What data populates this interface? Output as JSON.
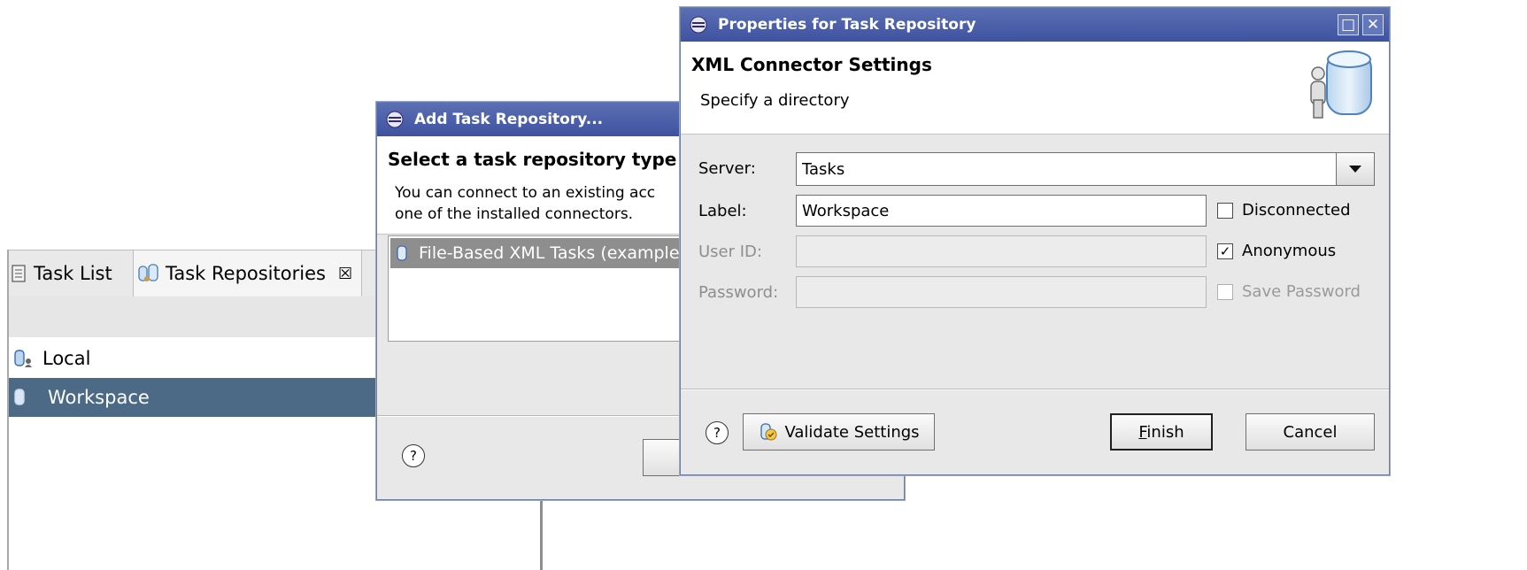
{
  "task_view": {
    "tabs": [
      {
        "label": "Task List"
      },
      {
        "label": "Task Repositories",
        "close": "☒"
      }
    ],
    "repositories": [
      {
        "label": "Local",
        "selected": false
      },
      {
        "label": "Workspace",
        "selected": true
      }
    ]
  },
  "add_dialog": {
    "title": "Add Task Repository...",
    "heading": "Select a task repository type",
    "description_line1": "You can connect to an existing acc",
    "description_line2": "one of the installed connectors.",
    "types": [
      {
        "label": "File-Based XML Tasks (example",
        "selected": true
      }
    ]
  },
  "props_dialog": {
    "title": "Properties for Task Repository",
    "heading": "XML Connector Settings",
    "description": "Specify a directory",
    "server": {
      "label": "Server:",
      "value": "Tasks"
    },
    "label_field": {
      "label": "Label:",
      "value": "Workspace"
    },
    "user_id": {
      "label": "User ID:",
      "value": ""
    },
    "password": {
      "label": "Password:",
      "value": ""
    },
    "checkboxes": {
      "disconnected": {
        "label": "Disconnected",
        "checked": false
      },
      "anonymous": {
        "label": "Anonymous",
        "checked": true
      },
      "save_password": {
        "label": "Save Password",
        "checked": false
      }
    },
    "buttons": {
      "help": "?",
      "validate": "Validate Settings",
      "finish_mnemonic": "F",
      "finish_rest": "inish",
      "cancel": "Cancel"
    }
  },
  "colors": {
    "titlebar": "#4a5ea8",
    "selection": "#4c6a85",
    "list_selection": "#8e8e8e"
  }
}
